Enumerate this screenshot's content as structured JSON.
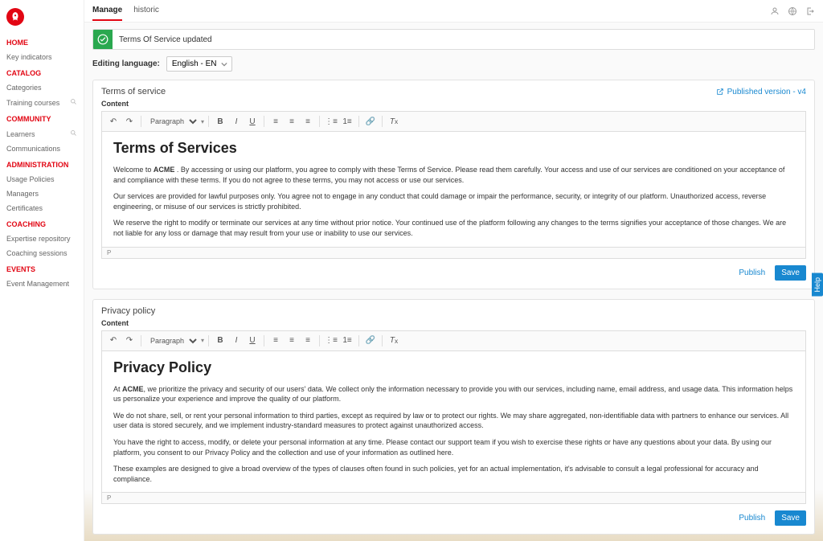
{
  "sidebar": {
    "sections": [
      {
        "title": "HOME",
        "items": [
          {
            "label": "Key indicators",
            "search": false
          }
        ]
      },
      {
        "title": "CATALOG",
        "items": [
          {
            "label": "Categories",
            "search": false
          },
          {
            "label": "Training courses",
            "search": true
          }
        ]
      },
      {
        "title": "COMMUNITY",
        "items": [
          {
            "label": "Learners",
            "search": true
          },
          {
            "label": "Communications",
            "search": false
          }
        ]
      },
      {
        "title": "ADMINISTRATION",
        "items": [
          {
            "label": "Usage Policies",
            "search": false
          },
          {
            "label": "Managers",
            "search": false
          },
          {
            "label": "Certificates",
            "search": false
          }
        ]
      },
      {
        "title": "COACHING",
        "items": [
          {
            "label": "Expertise repository",
            "search": false
          },
          {
            "label": "Coaching sessions",
            "search": false
          }
        ]
      },
      {
        "title": "EVENTS",
        "items": [
          {
            "label": "Event Management",
            "search": false
          }
        ]
      }
    ]
  },
  "tabs": {
    "manage": "Manage",
    "historic": "historic"
  },
  "alert": "Terms Of Service updated",
  "lang": {
    "label": "Editing language:",
    "value": "English - EN"
  },
  "tos": {
    "title": "Terms of service",
    "published": "Published version - v4",
    "contentLabel": "Content",
    "toolbarFormat": "Paragraph",
    "heading": "Terms of Services",
    "p1a": "Welcome to ",
    "p1bold": "ACME",
    "p1b": " . By accessing or using our platform, you agree to comply with these Terms of Service. Please read them carefully. Your access and use of our services are conditioned on your acceptance of and compliance with these terms. If you do not agree to these terms, you may not access or use our services.",
    "p2": "Our services are provided for lawful purposes only. You agree not to engage in any conduct that could damage or impair the performance, security, or integrity of our platform. Unauthorized access, reverse engineering, or misuse of our services is strictly prohibited.",
    "p3": "We reserve the right to modify or terminate our services at any time without prior notice. Your continued use of the platform following any changes to the terms signifies your acceptance of those changes. We are not liable for any loss or damage that may result from your use or inability to use our services.",
    "path": "P",
    "publish": "Publish",
    "save": "Save"
  },
  "pp": {
    "title": "Privacy policy",
    "contentLabel": "Content",
    "toolbarFormat": "Paragraph",
    "heading": "Privacy Policy",
    "p1a": "At ",
    "p1bold": "ACME",
    "p1b": ", we prioritize the privacy and security of our users' data. We collect only the information necessary to provide you with our services, including name, email address, and usage data. This information helps us personalize your experience and improve the quality of our platform.",
    "p2": "We do not share, sell, or rent your personal information to third parties, except as required by law or to protect our rights. We may share aggregated, non-identifiable data with partners to enhance our services. All user data is stored securely, and we implement industry-standard measures to protect against unauthorized access.",
    "p3": "You have the right to access, modify, or delete your personal information at any time. Please contact our support team if you wish to exercise these rights or have any questions about your data. By using our platform, you consent to our Privacy Policy and the collection and use of your information as outlined here.",
    "p4": "These examples are designed to give a broad overview of the types of clauses often found in such policies, yet for an actual implementation, it's advisable to consult a legal professional for accuracy and compliance.",
    "path": "P",
    "publish": "Publish",
    "save": "Save"
  },
  "help": "Help"
}
